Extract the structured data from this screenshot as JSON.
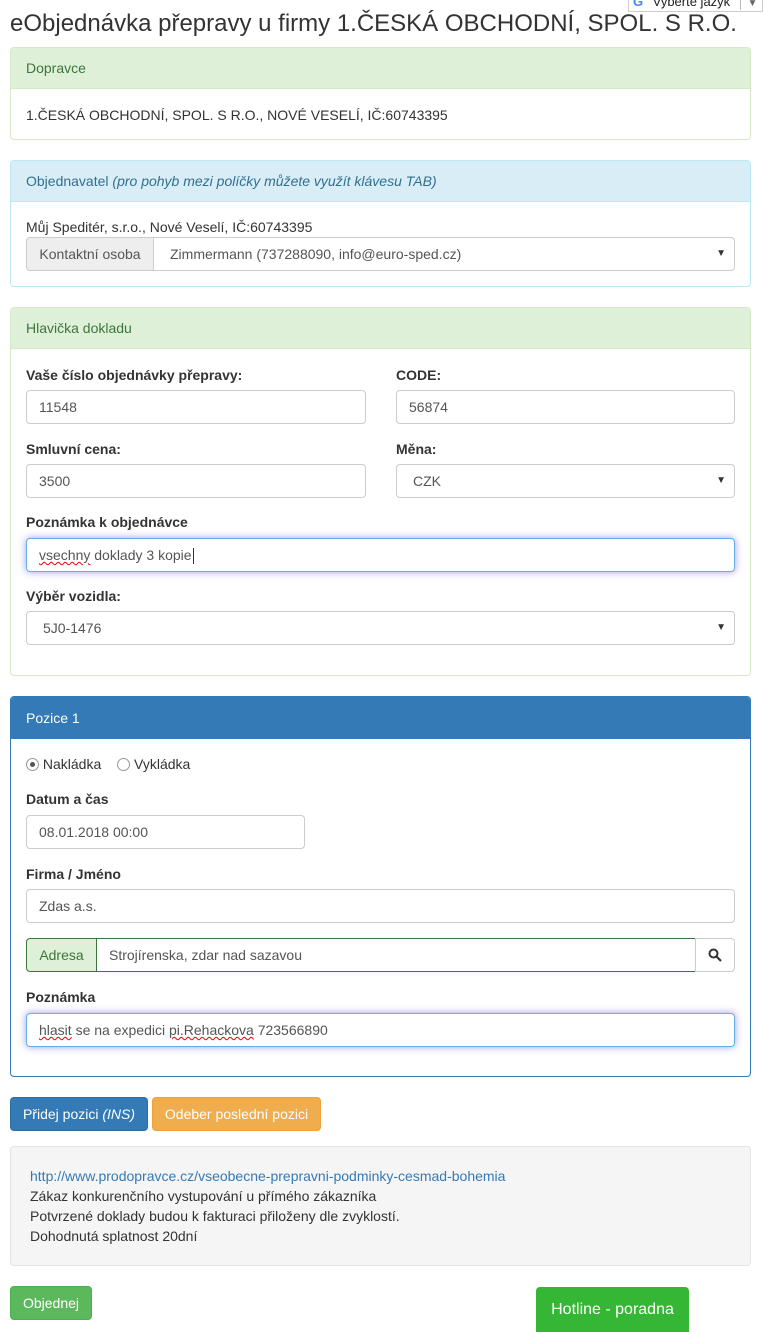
{
  "translate_widget": {
    "label": "Vyberte jazyk",
    "g_icon": "G"
  },
  "page": {
    "title": "eObjednávka přepravy u firmy 1.ČESKÁ OBCHODNÍ, SPOL. S R.O."
  },
  "dopravce": {
    "heading": "Dopravce",
    "text": "1.ČESKÁ OBCHODNÍ, SPOL. S R.O., NOVÉ VESELÍ, IČ:60743395"
  },
  "objednavatel": {
    "heading": "Objednavatel",
    "heading_hint": "(pro pohyb mezi políčky můžete využít klávesu TAB)",
    "company": "Můj Speditér, s.r.o., Nové Veselí, IČ:60743395",
    "contact_label": "Kontaktní osoba",
    "contact_value": "Zimmermann (737288090, info@euro-sped.cz)"
  },
  "hlavicka": {
    "heading": "Hlavička dokladu",
    "order_no_label": "Vaše číslo objednávky přepravy:",
    "order_no_value": "11548",
    "code_label": "CODE:",
    "code_value": "56874",
    "price_label": "Smluvní cena:",
    "price_value": "3500",
    "currency_label": "Měna:",
    "currency_value": "CZK",
    "note_label": "Poznámka k objednávce",
    "note_word1": "vsechny",
    "note_rest": " doklady 3 kopie",
    "vehicle_label": "Výběr vozidla:",
    "vehicle_value": "5J0-1476"
  },
  "pozice": {
    "heading": "Pozice 1",
    "radio_load": "Nakládka",
    "radio_unload": "Vykládka",
    "selected": "Nakládka",
    "datetime_label": "Datum a čas",
    "datetime_value": "08.01.2018 00:00",
    "firm_label": "Firma / Jméno",
    "firm_value": "Zdas a.s.",
    "address_label": "Adresa",
    "address_value": "Strojírenska, zdar nad sazavou",
    "note_label": "Poznámka",
    "note_word1": "hlasit",
    "note_mid": " se na expedici ",
    "note_word2": "pi.Rehackova",
    "note_tail": " 723566890"
  },
  "buttons": {
    "add_position": "Přidej pozici",
    "add_position_key": "(INS)",
    "remove_position": "Odeber poslední pozici",
    "order": "Objednej",
    "hotline": "Hotline - poradna"
  },
  "conditions": {
    "link": "http://www.prodopravce.cz/vseobecne-prepravni-podminky-cesmad-bohemia",
    "line1": "Zákaz konkurenčního vystupování u přímého zákazníka",
    "line2": "Potvrzené doklady budou k fakturaci přiloženy dle zvyklostí.",
    "line3": "Dohodnutá splatnost 20dní"
  },
  "colors": {
    "primary": "#337ab7",
    "warning": "#f0ad4e",
    "success": "#5cb85c",
    "hotline": "#35b735"
  }
}
